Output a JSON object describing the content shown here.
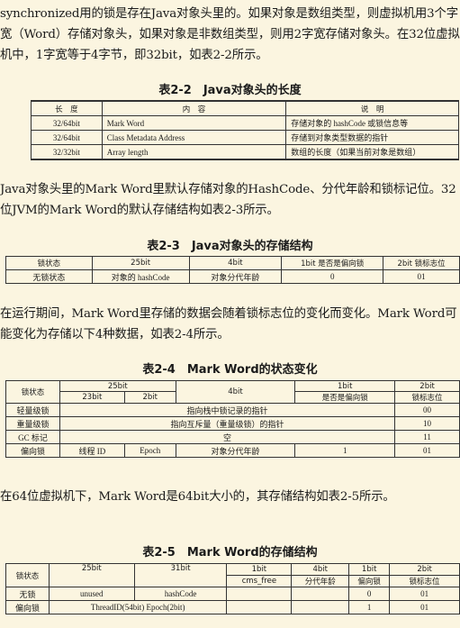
{
  "paragraphs": {
    "p1": "synchronized用的锁是存在Java对象头里的。如果对象是数组类型，则虚拟机用3个字宽（Word）存储对象头，如果对象是非数组类型，则用2字宽存储对象头。在32位虚拟机中，1字宽等于4字节，即32bit，如表2-2所示。",
    "p2": "Java对象头里的Mark Word里默认存储对象的HashCode、分代年龄和锁标记位。32位JVM的Mark Word的默认存储结构如表2-3所示。",
    "p3": "在运行期间，Mark Word里存储的数据会随着锁标志位的变化而变化。Mark Word可能变化为存储以下4种数据，如表2-4所示。",
    "p4": "在64位虚拟机下，Mark Word是64bit大小的，其存储结构如表2-5所示。"
  },
  "table22": {
    "caption": "表2-2　Java对象头的长度",
    "headers": [
      "长　度",
      "内　容",
      "说　明"
    ],
    "rows": [
      [
        "32/64bit",
        "Mark Word",
        "存储对象的 hashCode 或锁信息等"
      ],
      [
        "32/64bit",
        "Class Metadata Address",
        "存储到对象类型数据的指针"
      ],
      [
        "32/32bit",
        "Array length",
        "数组的长度（如果当前对象是数组）"
      ]
    ]
  },
  "table23": {
    "caption": "表2-3　Java对象头的存储结构",
    "headers": [
      "锁状态",
      "25bit",
      "4bit",
      "1bit 是否是偏向锁",
      "2bit 锁标志位"
    ],
    "row": [
      "无锁状态",
      "对象的 hashCode",
      "对象分代年龄",
      "0",
      "01"
    ]
  },
  "table24": {
    "caption": "表2-4　Mark Word的状态变化",
    "h_state": "锁状态",
    "h_25bit": "25bit",
    "h_23bit": "23bit",
    "h_2bit": "2bit",
    "h_4bit": "4bit",
    "h_1bit": "1bit",
    "h_biased": "是否是偏向锁",
    "h_2bit_flag": "2bit",
    "h_flag": "锁标志位",
    "rows": {
      "light": [
        "轻量级锁",
        "指向栈中锁记录的指针",
        "00"
      ],
      "heavy": [
        "重量级锁",
        "指向互斥量（重量级锁）的指针",
        "10"
      ],
      "gc": [
        "GC 标记",
        "空",
        "11"
      ],
      "biased": [
        "偏向锁",
        "线程 ID",
        "Epoch",
        "对象分代年龄",
        "1",
        "01"
      ]
    }
  },
  "table25": {
    "caption": "表2-5　Mark Word的存储结构",
    "h_state": "锁状态",
    "h_25bit": "25bit",
    "h_31bit": "31bit",
    "h_1bit_a": "1bit",
    "h_cms": "cms_free",
    "h_4bit": "4bit",
    "h_age": "分代年龄",
    "h_1bit_b": "1bit",
    "h_biased": "偏向锁",
    "h_2bit": "2bit",
    "h_flag": "锁标志位",
    "rows": {
      "unlocked": [
        "无锁",
        "unused",
        "hashCode",
        "0",
        "01"
      ],
      "biased": [
        "偏向锁",
        "ThreadID(54bit) Epoch(2bit)",
        "1",
        "01"
      ]
    }
  }
}
